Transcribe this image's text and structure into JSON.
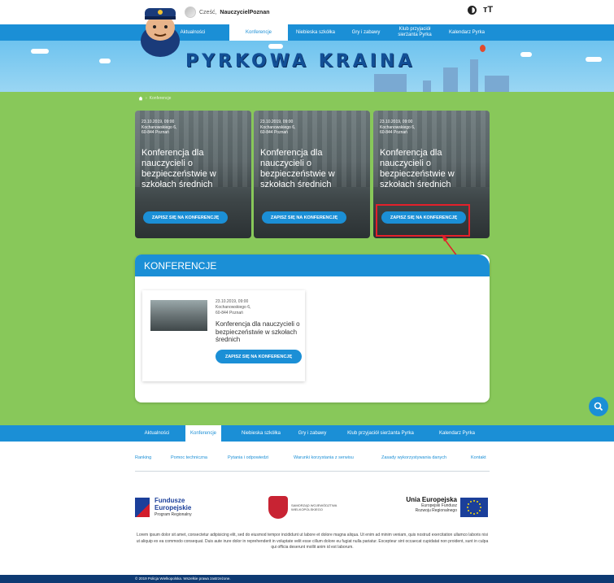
{
  "header": {
    "greeting": "Cześć,",
    "username": "NauczycielPoznan",
    "icons": [
      "contrast-icon",
      "font-size-icon"
    ],
    "font_size_label": "ᴛT"
  },
  "nav": {
    "items": [
      {
        "label": "Aktualności",
        "active": false
      },
      {
        "label": "Konferencje",
        "active": true
      },
      {
        "label": "Niebieska szkółka",
        "active": false
      },
      {
        "label": "Gry i zabawy",
        "active": false
      },
      {
        "label": "Klub przyjaciół sierżanta Pyrka",
        "active": false
      },
      {
        "label": "Kalendarz Pyrka",
        "active": false
      }
    ]
  },
  "banner": {
    "title": "PYRKOWA KRAINA"
  },
  "breadcrumb": {
    "home_icon": "home-icon",
    "current": "Konferencje"
  },
  "cards": [
    {
      "date": "23.10.2019, 09:00",
      "street": "Kochanowskiego 6,",
      "city": "60-844 Poznań",
      "title": "Konferencja dla nauczycieli o bezpieczeństwie w szkołach średnich",
      "button": "ZAPISZ SIĘ NA KONFERENCJĘ"
    },
    {
      "date": "23.10.2019, 09:00",
      "street": "Kochanowskiego 6,",
      "city": "60-844 Poznań",
      "title": "Konferencja dla nauczycieli o bezpieczeństwie w szkołach średnich",
      "button": "ZAPISZ SIĘ NA KONFERENCJĘ"
    },
    {
      "date": "23.10.2019, 09:00",
      "street": "Kochanowskiego 6,",
      "city": "60-844 Poznań",
      "title": "Konferencja dla nauczycieli o bezpieczeństwie w szkołach średnich",
      "button": "ZAPISZ SIĘ NA KONFERENCJĘ"
    }
  ],
  "section": {
    "heading": "KONFERENCJE",
    "item": {
      "date": "23.10.2019, 09:00",
      "street": "Kochanowskiego 6,",
      "city": "60-844 Poznań",
      "title": "Konferencja dla nauczycieli o bezpieczeństwie w szkołach średnich",
      "button": "ZAPISZ SIĘ NA KONFERENCJĘ"
    }
  },
  "search_fab_icon": "search-icon",
  "footer_nav": {
    "items": [
      {
        "label": "Aktualności",
        "active": false
      },
      {
        "label": "Konferencje",
        "active": true
      },
      {
        "label": "Niebieska szkółka",
        "active": false
      },
      {
        "label": "Gry i zabawy",
        "active": false
      },
      {
        "label": "Klub przyjaciół sierżanta Pyrka",
        "active": false
      },
      {
        "label": "Kalendarz Pyrka",
        "active": false
      }
    ]
  },
  "footer_links": [
    "Ranking",
    "Pomoc techniczna",
    "Pytania i odpowiedzi",
    "Warunki korzystania z serwisu",
    "Zasady wykorzystywania danych",
    "Kontakt"
  ],
  "logos": {
    "fe_line1": "Fundusze",
    "fe_line2": "Europejskie",
    "fe_sub": "Program Regionalny",
    "crest_line1": "SAMORZĄD WOJEWÓDZTWA",
    "crest_line2": "WIELKOPOLSKIEGO",
    "eu_title": "Unia Europejska",
    "eu_line1": "Europejski Fundusz",
    "eu_line2": "Rozwoju Regionalnego"
  },
  "lorem": "Lorem ipsum dolor sit amet, consectetur adipisicing elit, sed do eiusmod tempor incididunt ut labore et dolore magna aliqua. Ut enim ad minim veniam, quis nostrud exercitation ullamco laboris nisi ut aliquip ex ea commodo consequat. Duis aute irure dolor in reprehenderit in voluptate velit esse cillum dolore eu fugiat nulla pariatur. Excepteur sint occaecat cupidatat non proident, sunt in culpa qui officia deserunt mollit anim id est laborum.",
  "copyright": "© 2019 Policja Wielkopolska. Wszelkie prawa zastrzeżone.",
  "colors": {
    "primary": "#1b8fd6",
    "green": "#88c85a",
    "highlight": "#e3202a",
    "dark_blue": "#0e3a73"
  }
}
